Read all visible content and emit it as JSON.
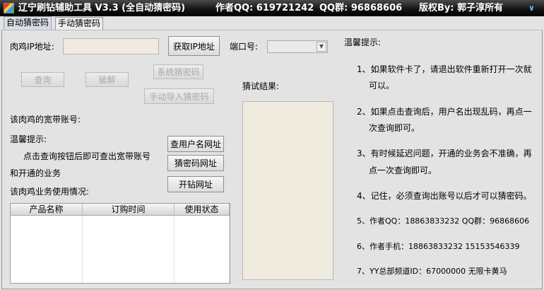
{
  "title": {
    "app": "辽宁刷钻辅助工具 V3.3 (全自动猜密码)",
    "author": "作者QQ: 619721242",
    "group": "QQ群: 96868606",
    "copyright": "版权By: 郭子淳所有",
    "menu_arrow": "∨"
  },
  "tabs": [
    {
      "label": "自动猜密码",
      "selected": true
    },
    {
      "label": "手动猜密码",
      "selected": false
    }
  ],
  "form": {
    "ip_label": "肉鸡IP地址:",
    "ip_value": "",
    "get_ip_button": "获取IP地址",
    "port_label": "端口号:",
    "port_value": "",
    "query_button": "查询",
    "crack_button": "破解",
    "system_guess_button": "系统猜密码",
    "manual_import_button": "手动导入猜密码",
    "result_label": "猜试结果:",
    "result_value": ""
  },
  "account": {
    "broadband_label": "该肉鸡的宽带账号:",
    "tip_title": "温馨提示:",
    "tip_line1": "点击查询按钮后即可查出宽带账号",
    "tip_line2": "和开通的业务",
    "usage_label": "该肉鸡业务使用情况:",
    "btn_user_url": "查用户名网址",
    "btn_guess_url": "猜密码网址",
    "btn_open_url": "开钻网址"
  },
  "table": {
    "columns": [
      "产品名称",
      "订购时间",
      "使用状态"
    ],
    "rows": []
  },
  "tips": {
    "title": "温馨提示:",
    "items": [
      [
        "1、如果软件卡了，请退出软件重新打开一次就",
        "可以。"
      ],
      [
        "2、如果点击查询后，用户名出现乱码，再点一",
        "次查询即可。"
      ],
      [
        "3、有时候延迟问题，开通的业务会不准确，再",
        "点一次查询即可。"
      ],
      [
        "4、记住，必须查询出账号以后才可以猜密码。"
      ],
      [
        "5、作者QQ：18863833232 QQ群：96868606"
      ],
      [
        "6、作者手机：18863833232 15153546339"
      ],
      [
        "7、YY总部频道ID：67000000 无限卡黄马"
      ]
    ]
  }
}
